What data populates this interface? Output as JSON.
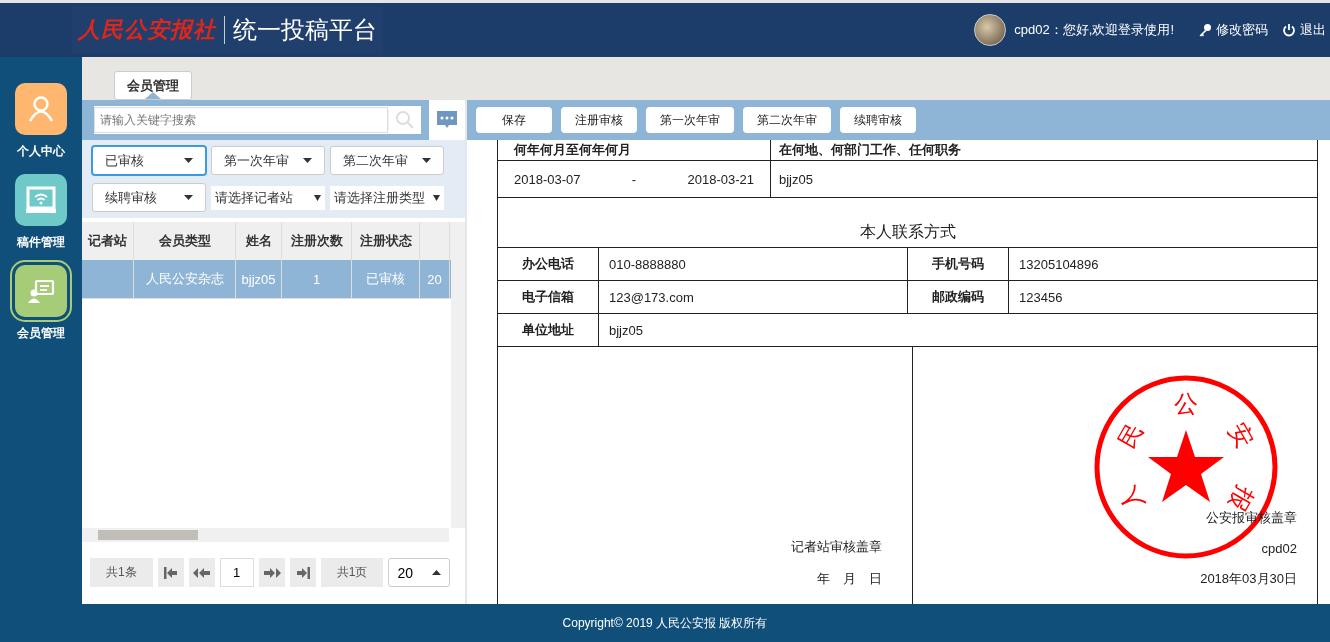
{
  "header": {
    "logo": "人民公安报社",
    "platform": "统一投稿平台",
    "greeting": "cpd02：您好,欢迎登录使用!",
    "change_password": "修改密码",
    "logout": "退出"
  },
  "sidebar": {
    "items": [
      {
        "label": "个人中心",
        "kind": "person",
        "color": "#ffb66e",
        "selected": false
      },
      {
        "label": "稿件管理",
        "kind": "monitor",
        "color": "#6fc9c9",
        "selected": false
      },
      {
        "label": "会员管理",
        "kind": "member",
        "color": "#a6cc78",
        "selected": true
      }
    ]
  },
  "tabs": [
    {
      "label": "会员管理",
      "selected": true
    }
  ],
  "search": {
    "placeholder": "请输入关键字搜索"
  },
  "filters": [
    {
      "kind": "select",
      "value": "已审核",
      "focused": true
    },
    {
      "kind": "select",
      "value": "第一次年审",
      "focused": false
    },
    {
      "kind": "select",
      "value": "第二次年审",
      "focused": false
    },
    {
      "kind": "select",
      "value": "续聘审核",
      "focused": false
    },
    {
      "kind": "plain",
      "value": "请选择记者站"
    },
    {
      "kind": "plain",
      "value": "请选择注册类型"
    }
  ],
  "table": {
    "columns": [
      "记者站",
      "会员类型",
      "姓名",
      "注册次数",
      "注册状态",
      ""
    ],
    "rows": [
      {
        "selected": true,
        "cells": [
          "",
          "人民公安杂志",
          "bjjz05",
          "1",
          "已审核",
          "20"
        ]
      }
    ]
  },
  "pager": {
    "total": "共1条",
    "page": "1",
    "pages": "共1页",
    "page_size": "20"
  },
  "toolbar": [
    "保存",
    "注册审核",
    "第一次年审",
    "第二次年审",
    "续聘审核"
  ],
  "form": {
    "history_header": [
      "何年何月至何年何月",
      "在何地、何部门工作、任何职务"
    ],
    "history": [
      {
        "from": "2018-03-07",
        "sep": "-",
        "to": "2018-03-21",
        "place": "bjjz05"
      }
    ],
    "contact_title": "本人联系方式",
    "contact": [
      [
        {
          "label": "办公电话",
          "value": "010-8888880"
        },
        {
          "label": "手机号码",
          "value": "13205104896"
        }
      ],
      [
        {
          "label": "电子信箱",
          "value": "123@173.com"
        },
        {
          "label": "邮政编码",
          "value": "123456"
        }
      ],
      [
        {
          "label": "单位地址",
          "value": "bjjz05"
        }
      ]
    ],
    "station_sign": {
      "title": "记者站审核盖章",
      "date": "年　月　日"
    },
    "paper_sign": {
      "title": "公安报审核盖章",
      "user": "cpd02",
      "date": "2018年03月30日"
    },
    "stamp": {
      "chars": [
        "人",
        "民",
        "公",
        "安",
        "报"
      ]
    }
  },
  "footer": "Copyright© 2019 人民公安报 版权所有"
}
